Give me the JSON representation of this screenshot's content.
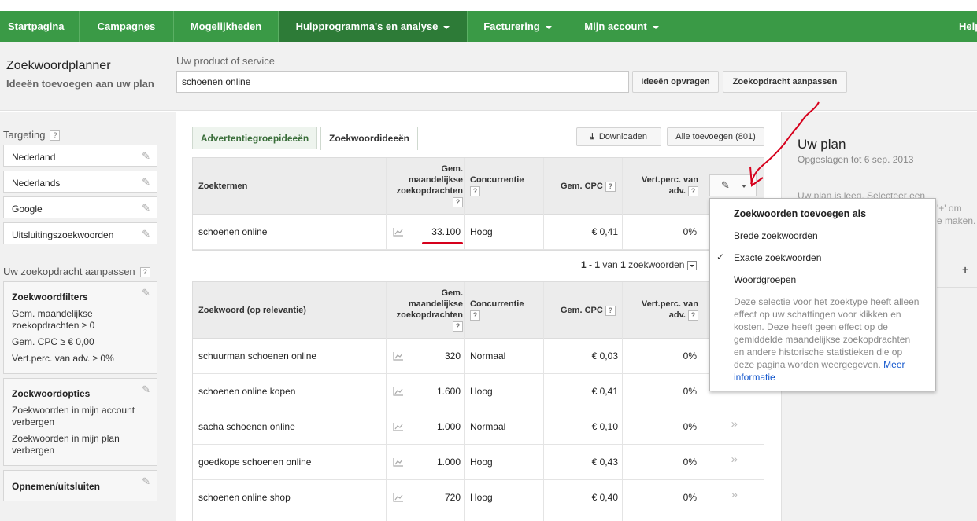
{
  "nav": {
    "items": [
      {
        "label": "Startpagina",
        "dropdown": false
      },
      {
        "label": "Campagnes",
        "dropdown": false
      },
      {
        "label": "Mogelijkheden",
        "dropdown": false
      },
      {
        "label": "Hulpprogramma's en analyse",
        "dropdown": true,
        "active": true
      },
      {
        "label": "Facturering",
        "dropdown": true
      },
      {
        "label": "Mijn account",
        "dropdown": true
      },
      {
        "label": "Help",
        "dropdown": false
      }
    ]
  },
  "header": {
    "title": "Zoekwoordplanner",
    "subtitle": "Ideeën toevoegen aan uw plan",
    "product_label": "Uw product of service",
    "product_value": "schoenen online",
    "get_ideas_button": "Ideeën opvragen",
    "modify_search_button": "Zoekopdracht aanpassen"
  },
  "sidebar": {
    "targeting_label": "Targeting",
    "targeting_items": [
      "Nederland",
      "Nederlands",
      "Google",
      "Uitsluitingszoekwoorden"
    ],
    "modify_label": "Uw zoekopdracht aanpassen",
    "filters": {
      "title": "Zoekwoordfilters",
      "lines": [
        "Gem. maandelijkse",
        "zoekopdrachten ≥ 0",
        "Gem. CPC ≥ € 0,00",
        "Vert.perc. van adv. ≥ 0%"
      ]
    },
    "options": {
      "title": "Zoekwoordopties",
      "lines": [
        "Zoekwoorden in mijn account",
        "verbergen",
        "Zoekwoorden in mijn plan",
        "verbergen"
      ]
    },
    "include_exclude": "Opnemen/uitsluiten"
  },
  "tabs": {
    "adgroup": "Advertentiegroepideeën",
    "keyword": "Zoekwoordideeën"
  },
  "actions": {
    "download": "Downloaden",
    "add_all": "Alle toevoegen (801)"
  },
  "search_terms_table": {
    "headers": {
      "term": "Zoektermen",
      "searches_1": "Gem.",
      "searches_2": "maandelijkse",
      "searches_3": "zoekopdrachten",
      "competition": "Concurrentie",
      "cpc": "Gem. CPC",
      "share_1": "Vert.perc. van",
      "share_2": "adv."
    },
    "row": {
      "term": "schoenen online",
      "searches": "33.100",
      "competition": "Hoog",
      "cpc": "€ 0,41",
      "share": "0%"
    }
  },
  "pager": {
    "range": "1 - 1",
    "of": "van",
    "count": "1",
    "unit": "zoekwoorden"
  },
  "keyword_table": {
    "headers": {
      "keyword": "Zoekwoord (op relevantie)",
      "searches_1": "Gem.",
      "searches_2": "maandelijkse",
      "searches_3": "zoekopdrachten",
      "competition": "Concurrentie",
      "cpc": "Gem. CPC",
      "share_1": "Vert.perc. van",
      "share_2": "adv."
    },
    "rows": [
      {
        "keyword": "schuurman schoenen online",
        "searches": "320",
        "competition": "Normaal",
        "cpc": "€ 0,03",
        "share": "0%"
      },
      {
        "keyword": "schoenen online kopen",
        "searches": "1.600",
        "competition": "Hoog",
        "cpc": "€ 0,41",
        "share": "0%"
      },
      {
        "keyword": "sacha schoenen online",
        "searches": "1.000",
        "competition": "Normaal",
        "cpc": "€ 0,10",
        "share": "0%"
      },
      {
        "keyword": "goedkope schoenen online",
        "searches": "1.000",
        "competition": "Hoog",
        "cpc": "€ 0,43",
        "share": "0%"
      },
      {
        "keyword": "schoenen online shop",
        "searches": "720",
        "competition": "Hoog",
        "cpc": "€ 0,40",
        "share": "0%"
      }
    ]
  },
  "plan": {
    "title": "Uw plan",
    "saved": "Opgeslagen tot 6 sep. 2013",
    "empty_1": "Uw plan is leeg. Selecteer een",
    "empty_2": "'+' om",
    "empty_3": "e maken."
  },
  "dropdown": {
    "title": "Zoekwoorden toevoegen als",
    "options": [
      "Brede zoekwoorden",
      "Exacte zoekwoorden",
      "Woordgroepen"
    ],
    "selected_index": 1,
    "description": "Deze selectie voor het zoektype heeft alleen effect op uw schattingen voor klikken en kosten. Deze heeft geen effect op de gemiddelde maandelijkse zoekopdrachten en andere historische statistieken die op deze pagina worden weergegeven.",
    "more_info": "Meer informatie"
  },
  "icons": {
    "pencil": "pencil-icon",
    "help": "help-icon",
    "check": "checkmark-icon",
    "download": "download-icon",
    "trend": "trend-chart-icon"
  },
  "colors": {
    "nav_green": "#3a9a46",
    "nav_active": "#2d7b37",
    "annotation_red": "#d6001c",
    "link_blue": "#1155cc"
  }
}
